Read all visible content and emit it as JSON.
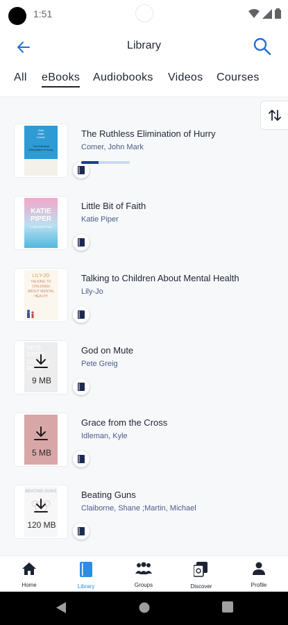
{
  "status_bar": {
    "time": "1:51"
  },
  "header": {
    "title": "Library"
  },
  "tabs": [
    {
      "label": "All"
    },
    {
      "label": "eBooks"
    },
    {
      "label": "Audiobooks"
    },
    {
      "label": "Videos"
    },
    {
      "label": "Courses"
    }
  ],
  "active_tab": "eBooks",
  "books": [
    {
      "title": "The Ruthless Elimination of Hurry",
      "author": "Comer, John Mark",
      "progress": 0.35,
      "downloaded": true,
      "cover": {
        "line1": "John",
        "line2": "Mark",
        "line3": "Comer",
        "sub": "The Ruthless Elimination of Hurry"
      }
    },
    {
      "title": "Little Bit of Faith",
      "author": "Katie Piper",
      "downloaded": true,
      "cover": {
        "line1": "KATIE",
        "line2": "PIPER",
        "sub": "A Little Bit of Faith"
      }
    },
    {
      "title": "Talking to Children About Mental Health",
      "author": "Lily-Jo",
      "downloaded": true,
      "cover": {
        "line1": "LILY-JO",
        "line2": "TALKING TO CHILDREN ABOUT MENTAL HEALTH"
      }
    },
    {
      "title": "God on Mute",
      "author": "Pete Greig",
      "downloaded": false,
      "size": "9 MB",
      "cover": {
        "line1": "PETE",
        "line2": "GREIG",
        "line3": "GOD ON MUTE"
      }
    },
    {
      "title": "Grace from the Cross",
      "author": "Idleman, Kyle",
      "downloaded": false,
      "size": "5 MB",
      "cover": {}
    },
    {
      "title": "Beating Guns",
      "author": "Claiborne, Shane ;Martin, Michael",
      "downloaded": false,
      "size": "120 MB",
      "cover": {
        "line1": "BEATING GUNS"
      }
    }
  ],
  "bottom_nav": [
    {
      "label": "Home",
      "icon": "home-icon"
    },
    {
      "label": "Library",
      "icon": "library-icon"
    },
    {
      "label": "Groups",
      "icon": "groups-icon"
    },
    {
      "label": "Discover",
      "icon": "discover-icon"
    },
    {
      "label": "Profile",
      "icon": "profile-icon"
    }
  ],
  "colors": {
    "accent": "#2b8ee0",
    "progress": "#1d3f8f",
    "author": "#4a5a8a"
  }
}
